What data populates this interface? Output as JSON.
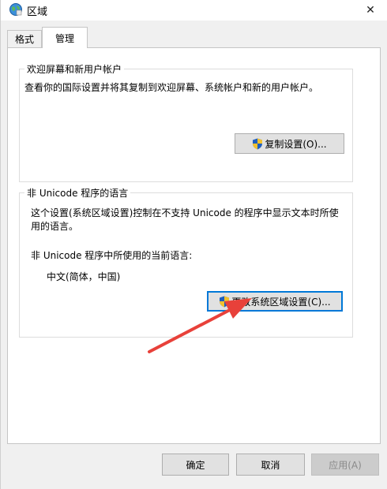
{
  "window": {
    "title": "区域",
    "icon": "globe-icon",
    "close_glyph": "✕"
  },
  "tabs": [
    {
      "label": "格式"
    },
    {
      "label": "管理"
    }
  ],
  "welcome_group": {
    "legend": "欢迎屏幕和新用户帐户",
    "description": "查看你的国际设置并将其复制到欢迎屏幕、系统帐户和新的用户帐户。",
    "copy_button": "复制设置(O)..."
  },
  "unicode_group": {
    "legend": "非 Unicode 程序的语言",
    "description_line1": "这个设置(系统区域设置)控制在不支持 Unicode 的程序中显示文本时所使",
    "description_line2": "用的语言。",
    "current_label": "非 Unicode 程序中所使用的当前语言:",
    "current_value": "中文(简体，中国)",
    "change_button": "更改系统区域设置(C)..."
  },
  "footer": {
    "ok": "确定",
    "cancel": "取消",
    "apply": "应用(A)"
  },
  "colors": {
    "accent": "#0078d7",
    "annotation_arrow": "#e8413a",
    "shield_blue": "#1f5fbf",
    "shield_yellow": "#f2c12e"
  }
}
